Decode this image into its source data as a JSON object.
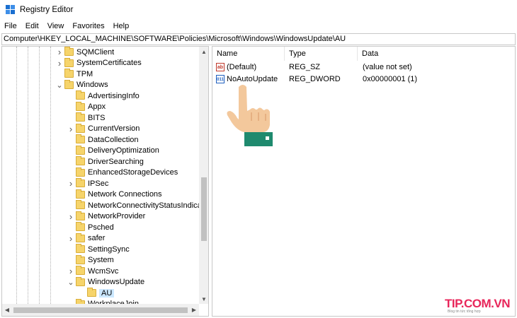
{
  "window": {
    "title": "Registry Editor"
  },
  "menu": [
    "File",
    "Edit",
    "View",
    "Favorites",
    "Help"
  ],
  "address": "Computer\\HKEY_LOCAL_MACHINE\\SOFTWARE\\Policies\\Microsoft\\Windows\\WindowsUpdate\\AU",
  "tree": [
    {
      "label": "SQMClient",
      "depth": 0,
      "expander": "collapsed"
    },
    {
      "label": "SystemCertificates",
      "depth": 0,
      "expander": "collapsed"
    },
    {
      "label": "TPM",
      "depth": 0,
      "expander": "none"
    },
    {
      "label": "Windows",
      "depth": 0,
      "expander": "expanded"
    },
    {
      "label": "AdvertisingInfo",
      "depth": 1,
      "expander": "none"
    },
    {
      "label": "Appx",
      "depth": 1,
      "expander": "none"
    },
    {
      "label": "BITS",
      "depth": 1,
      "expander": "none"
    },
    {
      "label": "CurrentVersion",
      "depth": 1,
      "expander": "collapsed"
    },
    {
      "label": "DataCollection",
      "depth": 1,
      "expander": "none"
    },
    {
      "label": "DeliveryOptimization",
      "depth": 1,
      "expander": "none"
    },
    {
      "label": "DriverSearching",
      "depth": 1,
      "expander": "none"
    },
    {
      "label": "EnhancedStorageDevices",
      "depth": 1,
      "expander": "none"
    },
    {
      "label": "IPSec",
      "depth": 1,
      "expander": "collapsed"
    },
    {
      "label": "Network Connections",
      "depth": 1,
      "expander": "none"
    },
    {
      "label": "NetworkConnectivityStatusIndicato",
      "depth": 1,
      "expander": "none"
    },
    {
      "label": "NetworkProvider",
      "depth": 1,
      "expander": "collapsed"
    },
    {
      "label": "Psched",
      "depth": 1,
      "expander": "none"
    },
    {
      "label": "safer",
      "depth": 1,
      "expander": "collapsed"
    },
    {
      "label": "SettingSync",
      "depth": 1,
      "expander": "none"
    },
    {
      "label": "System",
      "depth": 1,
      "expander": "none"
    },
    {
      "label": "WcmSvc",
      "depth": 1,
      "expander": "collapsed"
    },
    {
      "label": "WindowsUpdate",
      "depth": 1,
      "expander": "expanded"
    },
    {
      "label": "AU",
      "depth": 2,
      "expander": "none",
      "selected": true
    },
    {
      "label": "WorkplaceJoin",
      "depth": 1,
      "expander": "none"
    }
  ],
  "columns": {
    "name": "Name",
    "type": "Type",
    "data": "Data"
  },
  "values": [
    {
      "name": "(Default)",
      "type": "REG_SZ",
      "data": "(value not set)",
      "icon": "string-value-icon",
      "icon_text": "ab"
    },
    {
      "name": "NoAutoUpdate",
      "type": "REG_DWORD",
      "data": "0x00000001 (1)",
      "icon": "dword-value-icon",
      "icon_text": "011"
    }
  ],
  "watermark": {
    "main": "TIP.COM.VN",
    "sub": "Blog tin tức tổng hợp"
  },
  "colors": {
    "folder": "#f6d46b",
    "selection": "#cce8ff",
    "cuff": "#1f8a6e",
    "skin": "#f3c89c",
    "watermark": "#e8265a"
  }
}
